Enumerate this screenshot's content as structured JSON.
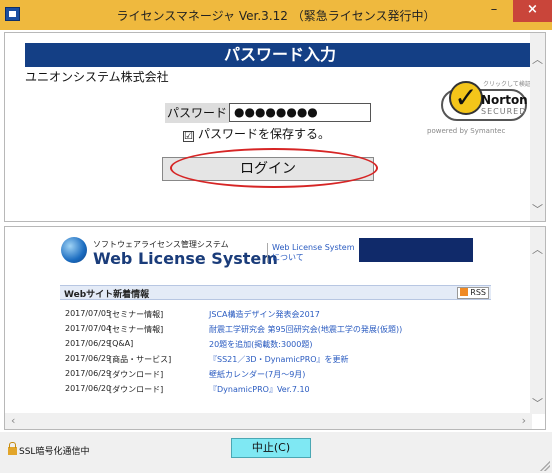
{
  "window": {
    "title": "ライセンスマネージャ Ver.3.12 （緊急ライセンス発行中）",
    "minimize": "–",
    "close": "×"
  },
  "login": {
    "header": "パスワード入力",
    "company": "ユニオンシステム株式会社",
    "password_label": "パスワード",
    "password_value": "●●●●●●●●",
    "save_checked": "☑",
    "save_label": "パスワードを保存する。",
    "login_button": "ログイン"
  },
  "norton": {
    "small": "クリックして検証",
    "name": "Norton",
    "secured": "SECURED",
    "powered": "powered by Symantec"
  },
  "wls": {
    "subtitle": "ソフトウェアライセンス管理システム",
    "name": "Web License System",
    "link_line1": "Web License System",
    "link_line2": "について",
    "news_title": "Webサイト新着情報",
    "rss": "RSS",
    "news": [
      {
        "date": "2017/07/05",
        "category": "[セミナー情報]",
        "title": "JSCA構造デザイン発表会2017"
      },
      {
        "date": "2017/07/04",
        "category": "[セミナー情報]",
        "title": "耐震工学研究会 第95回研究会(地震工学の発展(仮題))"
      },
      {
        "date": "2017/06/29",
        "category": "[Q&A]",
        "title": "20題を追加(掲載数:3000題)"
      },
      {
        "date": "2017/06/29",
        "category": "[商品・サービス]",
        "title": "『SS21／3D・DynamicPRO』を更新"
      },
      {
        "date": "2017/06/29",
        "category": "[ダウンロード]",
        "title": "壁紙カレンダー(7月～9月)"
      },
      {
        "date": "2017/06/20",
        "category": "[ダウンロード]",
        "title": "『DynamicPRO』Ver.7.10"
      }
    ]
  },
  "status": {
    "ssl": "SSL暗号化通信中",
    "stop_button": "中止(C)"
  }
}
